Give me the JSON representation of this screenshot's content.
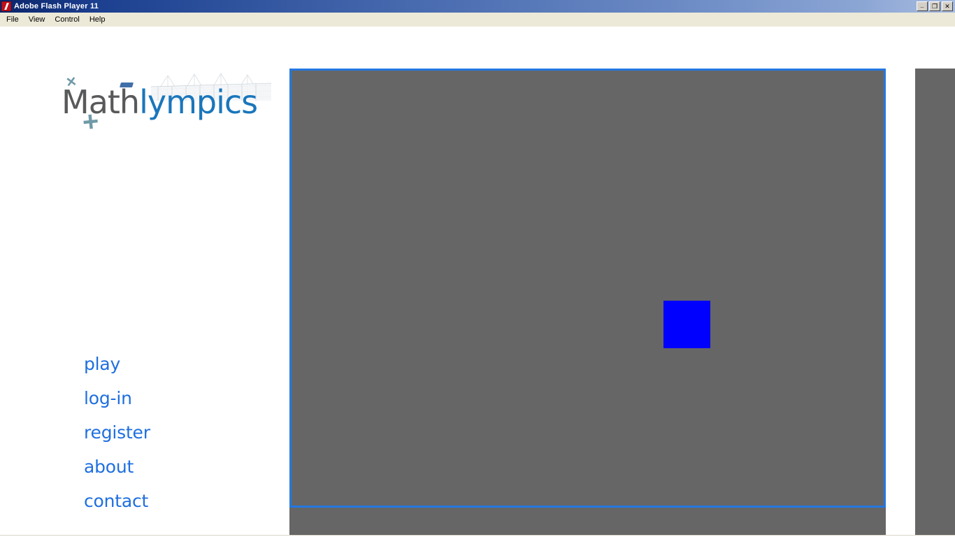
{
  "window": {
    "title": "Adobe Flash Player 11",
    "icon": "flash-logo-icon",
    "controls": {
      "minimize": "_",
      "restore": "❐",
      "close": "✕"
    }
  },
  "menubar": {
    "items": [
      {
        "label": "File"
      },
      {
        "label": "View"
      },
      {
        "label": "Control"
      },
      {
        "label": "Help"
      }
    ]
  },
  "logo": {
    "part_dark": "Math",
    "part_blue": "lympics",
    "decoration_x": "×",
    "decoration_plus": "+",
    "colors": {
      "dark": "#58595b",
      "blue": "#1a76bb",
      "accent_teal": "#6f9aa8",
      "dash_blue": "#3f6fa8"
    }
  },
  "nav": {
    "items": [
      {
        "label": "play"
      },
      {
        "label": "log-in"
      },
      {
        "label": "register"
      },
      {
        "label": "about"
      },
      {
        "label": "contact"
      }
    ],
    "link_color": "#1f6fe0"
  },
  "content": {
    "panel_fill": "#666666",
    "panel_border": "#2478e0",
    "square_color": "#0000ff"
  }
}
